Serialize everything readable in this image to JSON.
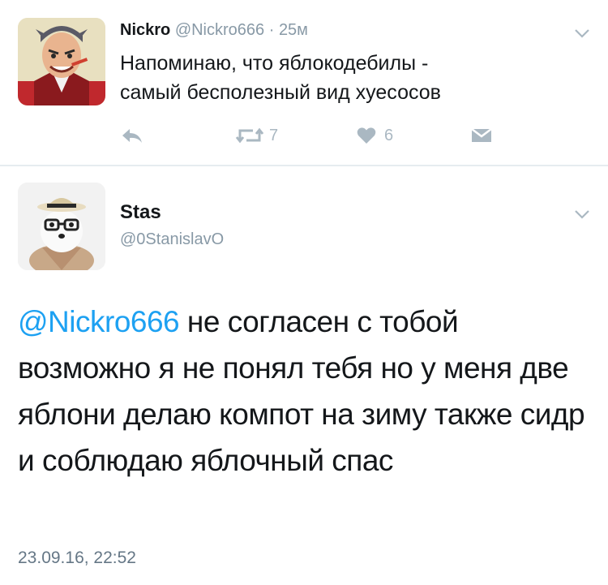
{
  "tweet1": {
    "name": "Nickro",
    "handle": "@Nickro666",
    "separator": " · ",
    "time": "25м",
    "text_line1": "Напоминаю, что яблокодебилы -",
    "text_line2": "самый бесполезный вид хуесосов",
    "retweets": "7",
    "likes": "6"
  },
  "tweet2": {
    "name": "Stas",
    "handle": "@0StanislavO",
    "mention": "@Nickro666",
    "text_rest": " не согласен с тобой возможно я не понял тебя но у меня две яблони делаю компот на зиму также сидр и соблюдаю яблочный спас",
    "timestamp": "23.09.16, 22:52"
  },
  "icons": [
    "reply-icon",
    "retweet-icon",
    "like-icon",
    "dm-icon",
    "chevron-down-icon"
  ],
  "colors": {
    "link": "#1da1f2",
    "muted": "#8899a6",
    "action": "#aab8c2",
    "text": "#14171a"
  }
}
